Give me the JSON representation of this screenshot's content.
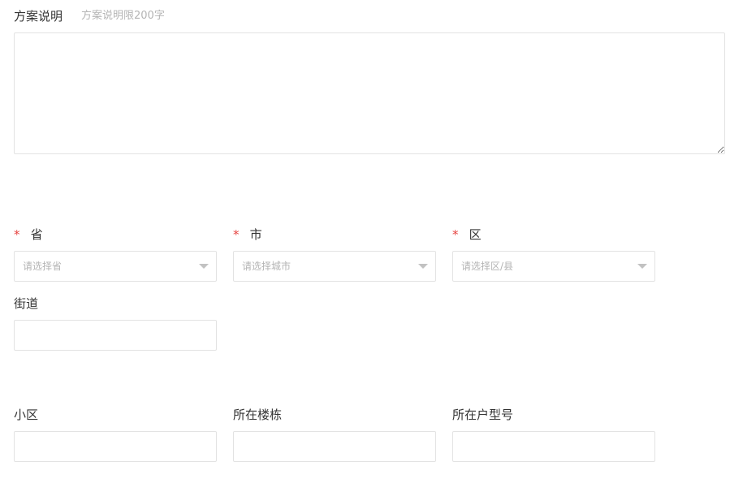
{
  "description": {
    "label": "方案说明",
    "hint": "方案说明限200字",
    "value": ""
  },
  "region": {
    "required_mark": "*",
    "province": {
      "label": "省",
      "placeholder": "请选择省"
    },
    "city": {
      "label": "市",
      "placeholder": "请选择城市"
    },
    "district": {
      "label": "区",
      "placeholder": "请选择区/县"
    }
  },
  "street": {
    "label": "街道",
    "value": ""
  },
  "community": {
    "label": "小区",
    "value": ""
  },
  "building": {
    "label": "所在楼栋",
    "value": ""
  },
  "unit_type": {
    "label": "所在户型号",
    "value": ""
  }
}
